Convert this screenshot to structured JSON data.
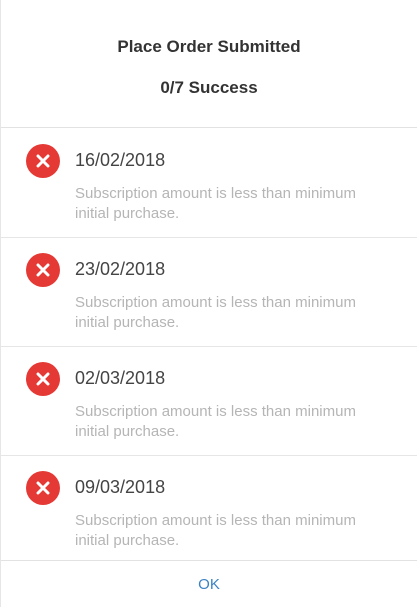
{
  "dialog": {
    "title": "Place Order Submitted",
    "subtitle": "0/7 Success",
    "ok_label": "OK"
  },
  "items": [
    {
      "date": "16/02/2018",
      "message": "Subscription amount is less than minimum initial purchase.",
      "status": "error-icon"
    },
    {
      "date": "23/02/2018",
      "message": "Subscription amount is less than minimum initial purchase.",
      "status": "error-icon"
    },
    {
      "date": "02/03/2018",
      "message": "Subscription amount is less than minimum initial purchase.",
      "status": "error-icon"
    },
    {
      "date": "09/03/2018",
      "message": "Subscription amount is less than minimum initial purchase.",
      "status": "error-icon"
    }
  ],
  "colors": {
    "error": "#e53935",
    "link": "#3b82c4"
  }
}
